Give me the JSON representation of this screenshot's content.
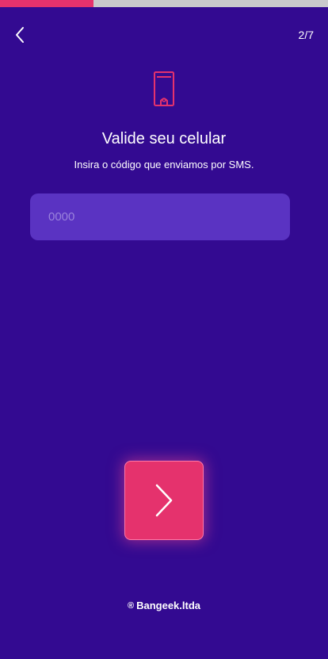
{
  "progress": {
    "fraction": 0.285,
    "fill_color": "#e5326d",
    "track_color": "#c9c9cc"
  },
  "header": {
    "back_icon": "chevron-left-icon",
    "step_counter": "2/7"
  },
  "hero": {
    "icon": "phone-icon",
    "title": "Valide seu celular",
    "subtitle": "Insira o código que enviamos por SMS."
  },
  "code_input": {
    "value": "",
    "placeholder": "0000"
  },
  "next_button": {
    "icon": "chevron-right-icon",
    "color": "#e5326d"
  },
  "footer": {
    "registered_mark": "®",
    "brand": "Bangeek.ltda"
  },
  "colors": {
    "background": "#330a91",
    "input_background": "#5a33c2",
    "accent": "#e5326d"
  }
}
